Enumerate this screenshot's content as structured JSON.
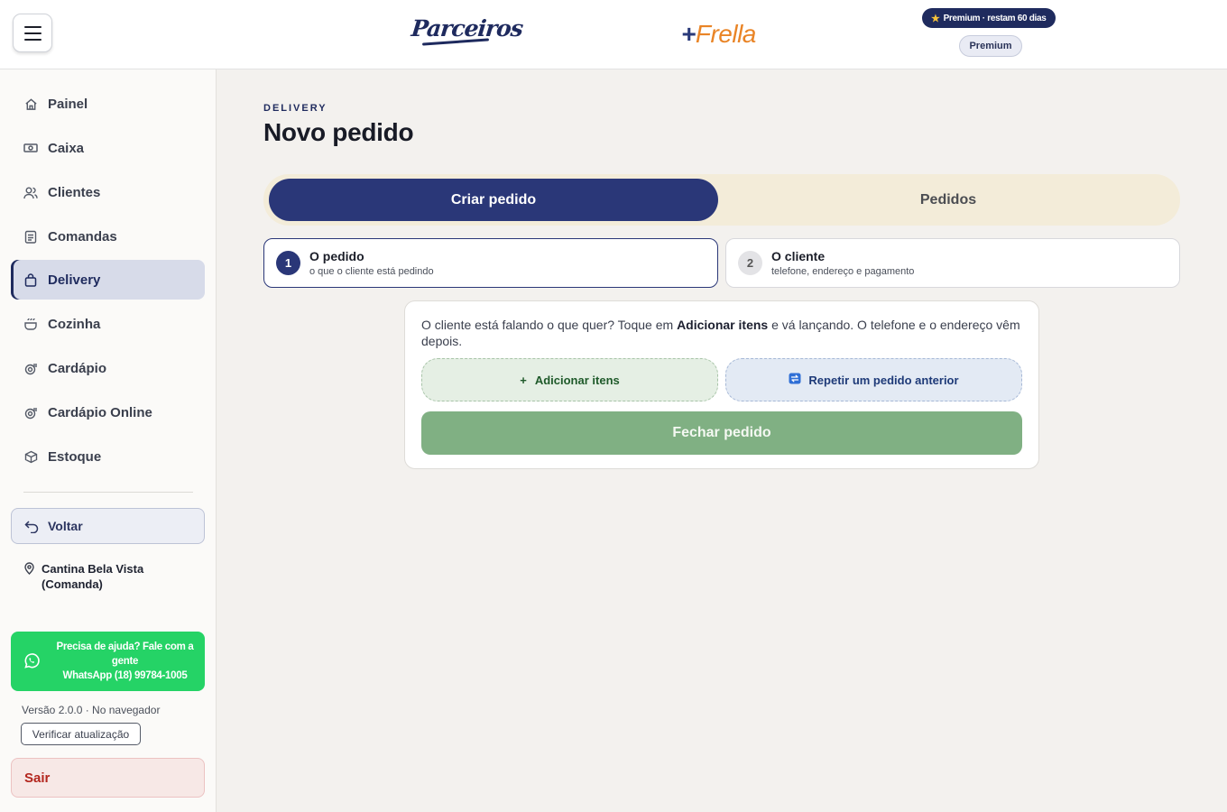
{
  "header": {
    "logo_parceiros": "Parceiros",
    "logo_frella_plus": "+",
    "logo_frella_text": "Frella",
    "premium_pill": "Premium · restam 60 dias",
    "premium_badge": "Premium"
  },
  "sidebar": {
    "items": [
      {
        "label": "Painel",
        "icon": "home-icon"
      },
      {
        "label": "Caixa",
        "icon": "cash-icon"
      },
      {
        "label": "Clientes",
        "icon": "users-icon"
      },
      {
        "label": "Comandas",
        "icon": "clipboard-icon"
      },
      {
        "label": "Delivery",
        "icon": "bag-icon",
        "active": true
      },
      {
        "label": "Cozinha",
        "icon": "pot-icon"
      },
      {
        "label": "Cardápio",
        "icon": "menu-book-icon"
      },
      {
        "label": "Cardápio Online",
        "icon": "menu-online-icon"
      },
      {
        "label": "Estoque",
        "icon": "box-icon"
      }
    ],
    "back_label": "Voltar",
    "store_name": "Cantina Bela Vista (Comanda)",
    "help_line1": "Precisa de ajuda? Fale com a gente",
    "help_line2": "WhatsApp (18) 99784-1005",
    "version_text": "Versão 2.0.0 · No navegador",
    "update_label": "Verificar atualização",
    "logout_label": "Sair"
  },
  "main": {
    "eyebrow": "DELIVERY",
    "title": "Novo pedido",
    "tabs": [
      {
        "label": "Criar pedido",
        "active": true
      },
      {
        "label": "Pedidos",
        "active": false
      }
    ],
    "steps": [
      {
        "number": "1",
        "title": "O pedido",
        "subtitle": "o que o cliente está pedindo",
        "active": true
      },
      {
        "number": "2",
        "title": "O cliente",
        "subtitle": "telefone, endereço e pagamento",
        "active": false
      }
    ],
    "card": {
      "text_before": "O cliente está falando o que quer? Toque em ",
      "text_bold": "Adicionar itens",
      "text_after": " e vá lançando. O telefone e o endereço vêm depois.",
      "add_icon": "+",
      "add_label": "Adicionar itens",
      "repeat_label": "Repetir um pedido anterior",
      "close_label": "Fechar pedido"
    }
  },
  "colors": {
    "primary": "#2a3778",
    "accent_orange": "#e98426",
    "whatsapp_green": "#25d366",
    "close_green": "#80b083",
    "logout_red": "#b3261e"
  }
}
